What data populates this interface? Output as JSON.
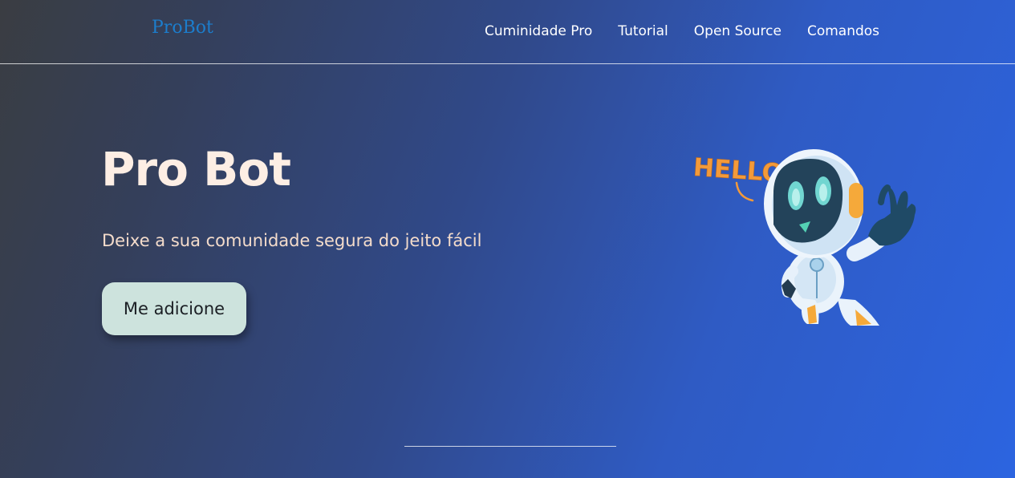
{
  "header": {
    "logo": "ProBot",
    "nav": [
      {
        "label": "Cuminidade Pro"
      },
      {
        "label": "Tutorial"
      },
      {
        "label": "Open Source"
      },
      {
        "label": "Comandos"
      }
    ]
  },
  "hero": {
    "title": "Pro Bot",
    "subtitle": "Deixe a sua comunidade segura do jeito fácil",
    "cta_label": "Me adicione",
    "illustration": {
      "icon": "robot-waving-icon",
      "speech_text": "HELLO!"
    }
  },
  "colors": {
    "accent": "#1c7dcc",
    "title": "#fdeee4",
    "subtitle": "#f4dccb",
    "button_bg": "#cde3dd",
    "speech": "#f39a3a"
  }
}
